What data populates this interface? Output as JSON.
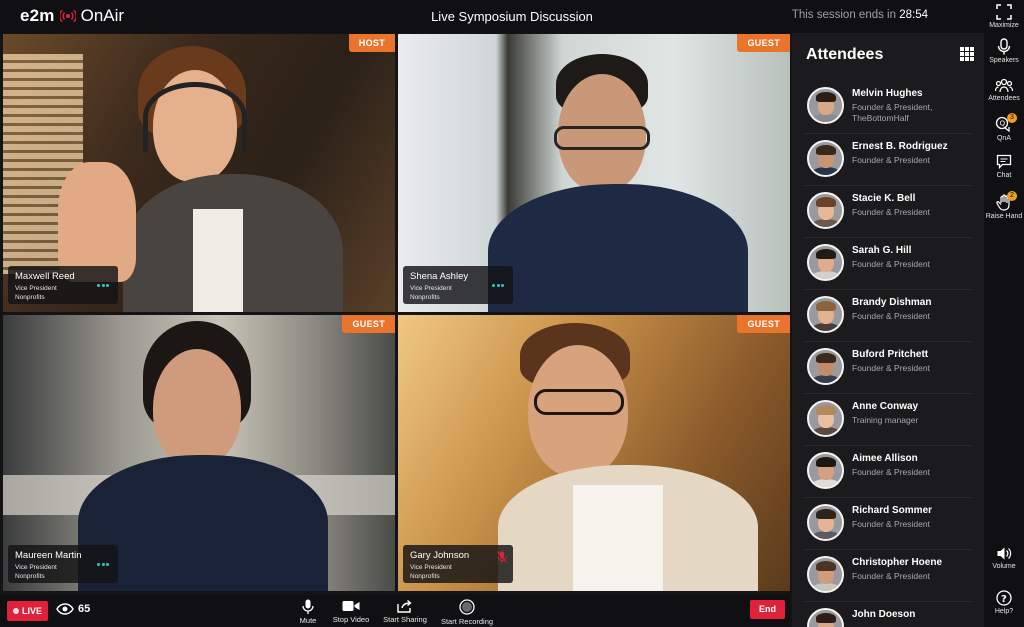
{
  "header": {
    "logo_mark": "e2m",
    "logo_product": "OnAir",
    "title": "Live Symposium Discussion",
    "session_ends_label": "This session ends in",
    "session_ends_time": "28:54"
  },
  "rail": {
    "maximize": "Maximize",
    "speakers": "Speakers",
    "attendees": "Attendees",
    "qna": "QnA",
    "qna_badge": "3",
    "chat": "Chat",
    "raise_hand": "Raise Hand",
    "raise_hand_badge": "2",
    "volume": "Volume",
    "help": "Help?"
  },
  "videos": [
    {
      "role_tag": "HOST",
      "name": "Maxwell Reed",
      "title": "Vice President",
      "org": "Nonprofits",
      "mic": "on"
    },
    {
      "role_tag": "GUEST",
      "name": "Shena Ashley",
      "title": "Vice President",
      "org": "Nonprofits",
      "mic": "on"
    },
    {
      "role_tag": "GUEST",
      "name": "Maureen Martin",
      "title": "Vice President",
      "org": "Nonprofits",
      "mic": "on"
    },
    {
      "role_tag": "GUEST",
      "name": "Gary Johnson",
      "title": "Vice President",
      "org": "Nonprofits",
      "mic": "muted"
    }
  ],
  "bottom": {
    "live": "LIVE",
    "viewers": "65",
    "mute": "Mute",
    "stop_video": "Stop Video",
    "start_sharing": "Start Sharing",
    "start_recording": "Start Recording",
    "end": "End"
  },
  "attendees": {
    "title": "Attendees",
    "list": [
      {
        "name": "Melvin Hughes",
        "role": "Founder & President, TheBottomHalf"
      },
      {
        "name": "Ernest B. Rodriguez",
        "role": "Founder & President"
      },
      {
        "name": "Stacie K. Bell",
        "role": "Founder & President"
      },
      {
        "name": "Sarah G. Hill",
        "role": "Founder & President"
      },
      {
        "name": "Brandy Dishman",
        "role": "Founder & President"
      },
      {
        "name": "Buford Pritchett",
        "role": "Founder & President"
      },
      {
        "name": "Anne Conway",
        "role": "Training manager"
      },
      {
        "name": "Aimee Allison",
        "role": "Founder & President"
      },
      {
        "name": "Richard Sommer",
        "role": "Founder & President"
      },
      {
        "name": "Christopher Hoene",
        "role": "Founder & President"
      },
      {
        "name": "John Doeson",
        "role": ""
      }
    ]
  },
  "colors": {
    "accent_orange": "#e9742c",
    "live_red": "#e0213a",
    "speaking_teal": "#33c6c6",
    "badge_amber": "#f0a020"
  }
}
